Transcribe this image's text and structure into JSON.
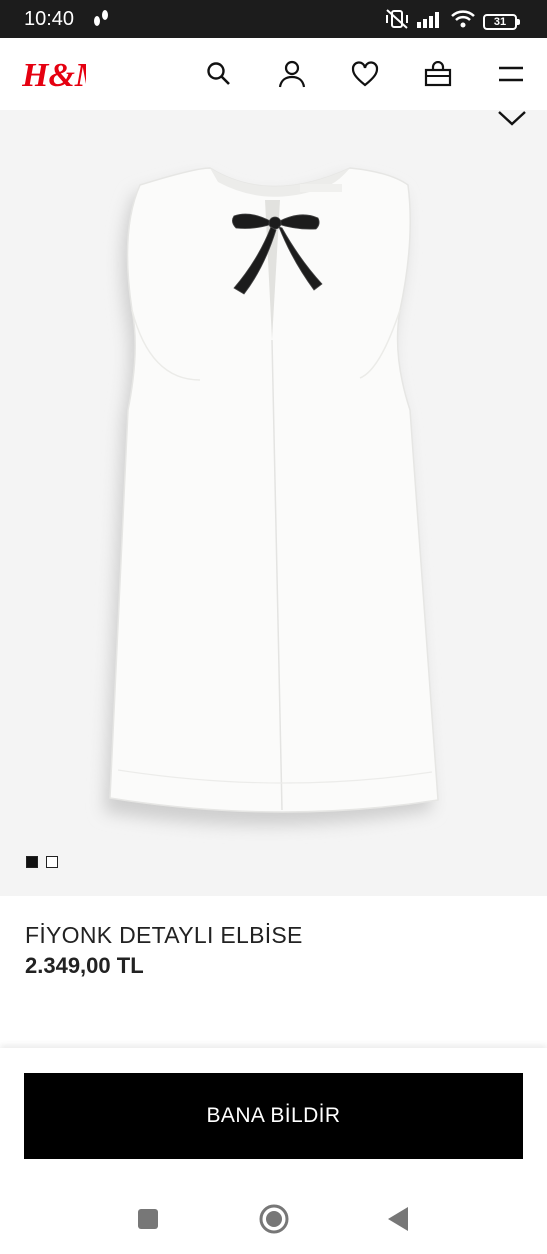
{
  "status_bar": {
    "time": "10:40",
    "battery": "31",
    "icons": [
      "footsteps-icon",
      "mute-vibrate-icon",
      "signal-icon",
      "wifi-icon",
      "battery-icon"
    ]
  },
  "header": {
    "logo_text": "H&M",
    "brand_color": "#e50010",
    "icons": [
      "search-icon",
      "account-icon",
      "heart-icon",
      "bag-icon",
      "menu-icon"
    ]
  },
  "product": {
    "name": "FİYONK DETAYLI ELBİSE",
    "price": "2.349,00 TL",
    "image_description_icon": "white-sleeveless-dress-with-black-bow",
    "image_count": 2,
    "active_image_index": 0
  },
  "cta": {
    "notify_label": "BANA BİLDİR"
  },
  "nav_bar": {
    "icons": [
      "recents-square-icon",
      "home-circle-icon",
      "back-triangle-icon"
    ]
  }
}
